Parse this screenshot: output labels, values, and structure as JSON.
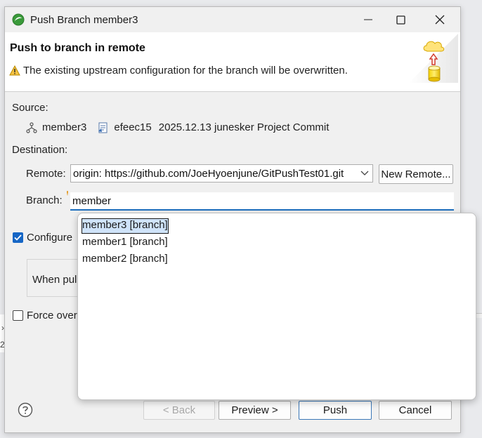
{
  "window": {
    "title": "Push Branch member3"
  },
  "banner": {
    "title": "Push to branch in remote",
    "warning": "The existing upstream configuration for the branch will be overwritten."
  },
  "source": {
    "label": "Source:",
    "branch": "member3",
    "commit_id": "efeec15",
    "commit_desc": "2025.12.13 junesker Project Commit"
  },
  "destination": {
    "label": "Destination:",
    "remote_label": "Remote:",
    "remote_value": "origin: https://github.com/JoeHyoenjune/GitPushTest01.git",
    "new_remote_button": "New Remote...",
    "branch_label": "Branch:",
    "branch_value": "member"
  },
  "options": {
    "configure_label": "Configure",
    "configure_checked": true,
    "when_label": "When pul",
    "force_label": "Force over",
    "force_checked": false
  },
  "suggestions": [
    {
      "text": "member3 [branch]",
      "selected": true
    },
    {
      "text": "member1 [branch]",
      "selected": false
    },
    {
      "text": "member2 [branch]",
      "selected": false
    }
  ],
  "footer": {
    "back": "< Back",
    "preview": "Preview >",
    "push": "Push",
    "cancel": "Cancel"
  },
  "behind": {
    "glyph_top": "›",
    "glyph_bottom": "2"
  },
  "colors": {
    "accent": "#1666c5",
    "focus_underline": "#1d6fbf",
    "selection": "#cfe3f9"
  }
}
